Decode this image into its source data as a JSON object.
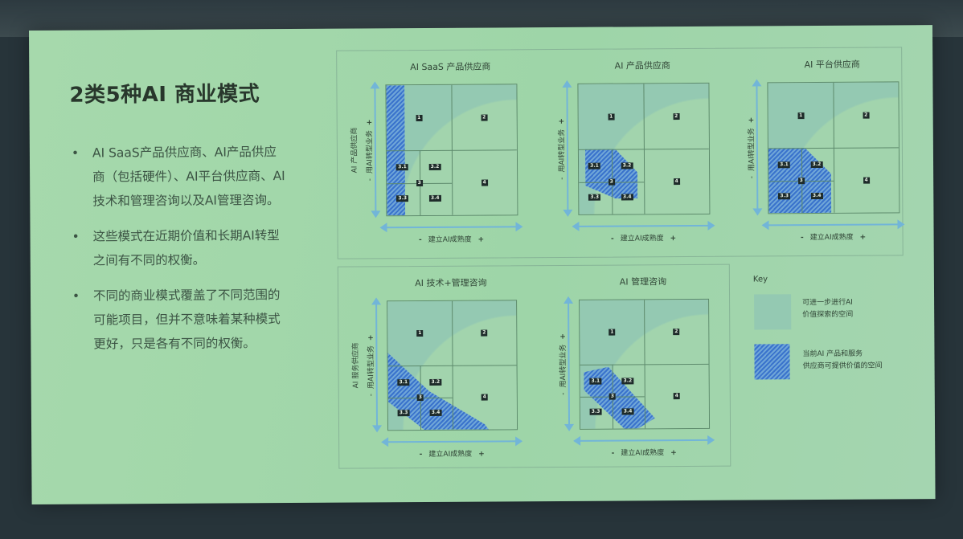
{
  "slide": {
    "title": "2类5种AI 商业模式",
    "bullets": [
      "AI SaaS产品供应商、AI产品供应商（包括硬件）、AI平台供应商、AI技术和管理咨询以及AI管理咨询。",
      "这些模式在近期价值和长期AI转型之间有不同的权衡。",
      "不同的商业模式覆盖了不同范围的可能项目，但并不意味着某种模式更好，只是各有不同的权衡。"
    ]
  },
  "panels": [
    {
      "title": "AI SaaS 产品供应商",
      "ylabel": "AI 产品供应商",
      "ylabel2": "用AI转型业务"
    },
    {
      "title": "AI 产品供应商",
      "ylabel2": "用AI转型业务"
    },
    {
      "title": "AI 平台供应商",
      "ylabel2": "用AI转型业务"
    },
    {
      "title": "AI 技术+管理咨询",
      "ylabel": "AI 服务供应商",
      "ylabel2": "用AI转型业务"
    },
    {
      "title": "AI 管理咨询",
      "ylabel2": "用AI转型业务"
    }
  ],
  "axis": {
    "x_label": "建立AI成熟度",
    "minus": "-",
    "plus": "+"
  },
  "cells": {
    "c1": "1",
    "c2": "2",
    "c4": "4",
    "c31": "3.1",
    "c32": "3.2",
    "c33": "3.3",
    "c34": "3.4",
    "c3": "3"
  },
  "key": {
    "title": "Key",
    "item1": {
      "line1": "可进一步进行AI",
      "line2": "价值探索的空间"
    },
    "item2": {
      "line1": "当前AI 产品和服务",
      "line2": "供应商可提供价值的空间"
    }
  },
  "colors": {
    "slide_bg": "#a3d7ab",
    "shade": "#94c9b2",
    "hatch": "#3a73cc",
    "arrow": "#72b5d8",
    "badge": "#1e2b2a"
  }
}
